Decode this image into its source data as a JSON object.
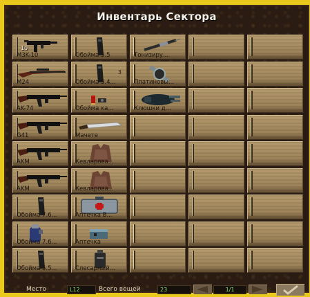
{
  "window": {
    "title": "Инвентарь Сектора"
  },
  "slots": [
    {
      "label": "M3K-10",
      "qty": "10",
      "qty_right": "",
      "icon": "smg-icon"
    },
    {
      "label": "Обойма 5.5",
      "qty": "",
      "qty_right": "",
      "icon": "magazine-icon"
    },
    {
      "label": "Тонизиру...",
      "qty": "",
      "qty_right": "",
      "icon": "syringe-icon"
    },
    {
      "label": "",
      "qty": "",
      "qty_right": "",
      "icon": ""
    },
    {
      "label": "",
      "qty": "",
      "qty_right": "",
      "icon": ""
    },
    {
      "label": "M24",
      "qty": "",
      "qty_right": "",
      "icon": "sniper-rifle-icon"
    },
    {
      "label": "Обойма 5.4...",
      "qty": "",
      "qty_right": "3",
      "icon": "magazine-icon"
    },
    {
      "label": "Платиновы...",
      "qty": "",
      "qty_right": "",
      "icon": "watch-icon"
    },
    {
      "label": "",
      "qty": "",
      "qty_right": "",
      "icon": ""
    },
    {
      "label": "",
      "qty": "",
      "qty_right": "",
      "icon": ""
    },
    {
      "label": "AK-74",
      "qty": "",
      "qty_right": "",
      "icon": "rifle-icon"
    },
    {
      "label": "Обойма ка...",
      "qty": "",
      "qty_right": "",
      "icon": "shotgun-shells-icon"
    },
    {
      "label": "Клюшки д...",
      "qty": "",
      "qty_right": "",
      "icon": "golf-bag-icon"
    },
    {
      "label": "",
      "qty": "",
      "qty_right": "",
      "icon": ""
    },
    {
      "label": "",
      "qty": "",
      "qty_right": "",
      "icon": ""
    },
    {
      "label": "G41",
      "qty": "",
      "qty_right": "",
      "icon": "rifle-icon"
    },
    {
      "label": "Мачете",
      "qty": "",
      "qty_right": "",
      "icon": "machete-icon"
    },
    {
      "label": "",
      "qty": "",
      "qty_right": "",
      "icon": ""
    },
    {
      "label": "",
      "qty": "",
      "qty_right": "",
      "icon": ""
    },
    {
      "label": "",
      "qty": "",
      "qty_right": "",
      "icon": ""
    },
    {
      "label": "AKM",
      "qty": "",
      "qty_right": "",
      "icon": "rifle-icon"
    },
    {
      "label": "Кевларова...",
      "qty": "",
      "qty_right": "",
      "icon": "vest-icon"
    },
    {
      "label": "",
      "qty": "",
      "qty_right": "",
      "icon": ""
    },
    {
      "label": "",
      "qty": "",
      "qty_right": "",
      "icon": ""
    },
    {
      "label": "",
      "qty": "",
      "qty_right": "",
      "icon": ""
    },
    {
      "label": "AKM",
      "qty": "",
      "qty_right": "",
      "icon": "rifle-icon"
    },
    {
      "label": "Кевларова...",
      "qty": "",
      "qty_right": "",
      "icon": "vest-icon"
    },
    {
      "label": "",
      "qty": "",
      "qty_right": "",
      "icon": ""
    },
    {
      "label": "",
      "qty": "",
      "qty_right": "",
      "icon": ""
    },
    {
      "label": "",
      "qty": "",
      "qty_right": "",
      "icon": ""
    },
    {
      "label": "Обойма 7.6...",
      "qty": "",
      "qty_right": "",
      "icon": "magazine-icon"
    },
    {
      "label": "Аптечка В...",
      "qty": "",
      "qty_right": "",
      "icon": "medkit-icon"
    },
    {
      "label": "",
      "qty": "",
      "qty_right": "",
      "icon": ""
    },
    {
      "label": "",
      "qty": "",
      "qty_right": "",
      "icon": ""
    },
    {
      "label": "",
      "qty": "",
      "qty_right": "",
      "icon": ""
    },
    {
      "label": "Обойма 7.6...",
      "qty": "",
      "qty_right": "",
      "icon": "grenade-icon"
    },
    {
      "label": "Аптечка",
      "qty": "",
      "qty_right": "",
      "icon": "first-aid-kit-icon"
    },
    {
      "label": "",
      "qty": "",
      "qty_right": "",
      "icon": ""
    },
    {
      "label": "",
      "qty": "",
      "qty_right": "",
      "icon": ""
    },
    {
      "label": "",
      "qty": "",
      "qty_right": "",
      "icon": ""
    },
    {
      "label": "Обойма 5.5...",
      "qty": "",
      "qty_right": "",
      "icon": "magazine-icon"
    },
    {
      "label": "Слесарный...",
      "qty": "",
      "qty_right": "",
      "icon": "toolkit-icon"
    },
    {
      "label": "",
      "qty": "",
      "qty_right": "",
      "icon": ""
    },
    {
      "label": "",
      "qty": "",
      "qty_right": "",
      "icon": ""
    },
    {
      "label": "",
      "qty": "",
      "qty_right": "",
      "icon": ""
    }
  ],
  "status": {
    "place_label": "Место",
    "place_value": "L12",
    "total_label": "Всего вещей",
    "total_value": "23",
    "page_value": "1/1"
  },
  "colors": {
    "outer": "#e9c91c",
    "panel": "#2a1c12",
    "slot": "#a78d61",
    "value_text": "#8ee078"
  }
}
